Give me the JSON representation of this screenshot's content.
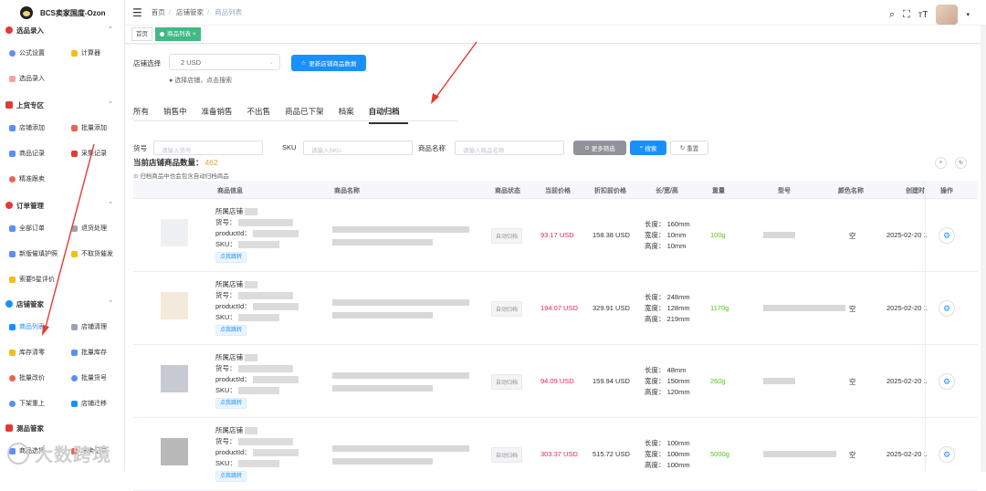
{
  "app": {
    "title": "BCS卖家国度-Ozon"
  },
  "sidebar": {
    "sections": [
      {
        "title": "选品录入",
        "items": [
          "公式设置",
          "计算器",
          "选品录入"
        ]
      },
      {
        "title": "上货专区",
        "items": [
          "店铺添加",
          "批量添加",
          "商品记录",
          "采集记录",
          "精准跟卖"
        ]
      },
      {
        "title": "订单管理",
        "items": [
          "全部订单",
          "退货处理",
          "新版催填护照",
          "不取货催发",
          "索要5星评价"
        ]
      },
      {
        "title": "店铺管家",
        "items": [
          "商品列表",
          "店铺清理",
          "库存清零",
          "批量库存",
          "批量改价",
          "批量货号",
          "下架重上",
          "店铺迁移"
        ]
      },
      {
        "title": "测品管家",
        "items": [
          "商品选择",
          "跟卖记录"
        ]
      }
    ],
    "watermark": "大数跨境"
  },
  "header": {
    "breadcrumb": [
      "首页",
      "店铺管家",
      "商品列表"
    ]
  },
  "tags": [
    "首页",
    "商品列表"
  ],
  "store": {
    "label": "店铺选择",
    "value": "2 USD",
    "update_button": "更新店铺商品数据",
    "hint": "选择店铺，点击搜索"
  },
  "tabs": [
    "所有",
    "销售中",
    "准备销售",
    "不出售",
    "商品已下架",
    "档案",
    "自动归档"
  ],
  "filters": {
    "sku_no_label": "货号",
    "sku_no_placeholder": "请输入货号",
    "sku_label": "SKU",
    "sku_placeholder": "请输入SKU",
    "name_label": "商品名称",
    "name_placeholder": "请输入商品名称",
    "more": "更多筛选",
    "search": "搜索",
    "reset": "重置"
  },
  "summary": {
    "label": "当前店铺商品数量：",
    "count": "462",
    "note": "归档商品中也会包含自动归档商品"
  },
  "table": {
    "headers": [
      "商品信息",
      "商品名称",
      "商品状态",
      "当前价格",
      "折扣前价格",
      "长/宽/高",
      "重量",
      "型号",
      "颜色名称",
      "创建时",
      "操作"
    ],
    "info_labels": {
      "store": "所属店铺",
      "sku_no": "货号：",
      "pid": "productId：",
      "sku": "SKU：",
      "jump": "点我跳转"
    },
    "rows": [
      {
        "status": "自动归档",
        "price": "93.17 USD",
        "orig": "158.38 USD",
        "len": "长度：  160mm",
        "wid": "宽度：  10mm",
        "hei": "高度：  10mm",
        "weight": "100g",
        "color": "空",
        "date": "2025-02-20 1"
      },
      {
        "status": "自动归档",
        "price": "194.07 USD",
        "orig": "329.91 USD",
        "len": "长度：  248mm",
        "wid": "宽度：  128mm",
        "hei": "高度：  219mm",
        "weight": "1170g",
        "color": "空",
        "date": "2025-02-20 1"
      },
      {
        "status": "自动归档",
        "price": "94.09 USD",
        "orig": "159.94 USD",
        "len": "长度：  48mm",
        "wid": "宽度：  150mm",
        "hei": "高度：  120mm",
        "weight": "260g",
        "color": "空",
        "date": "2025-02-20 1"
      },
      {
        "status": "自动归档",
        "price": "303.37 USD",
        "orig": "515.72 USD",
        "len": "长度：  100mm",
        "wid": "宽度：  100mm",
        "hei": "高度：  100mm",
        "weight": "5000g",
        "color": "空",
        "date": "2025-02-20 1"
      }
    ]
  },
  "colors": {
    "primary": "#1890ff",
    "price": "#e91e63",
    "weight": "#52c41a",
    "count": "#e6a23c",
    "arrow": "#e53935"
  },
  "icons": [
    "menu-icon",
    "search-icon",
    "fullscreen-icon",
    "font-size-icon",
    "gear-icon",
    "refresh-icon",
    "search-circle-icon"
  ]
}
